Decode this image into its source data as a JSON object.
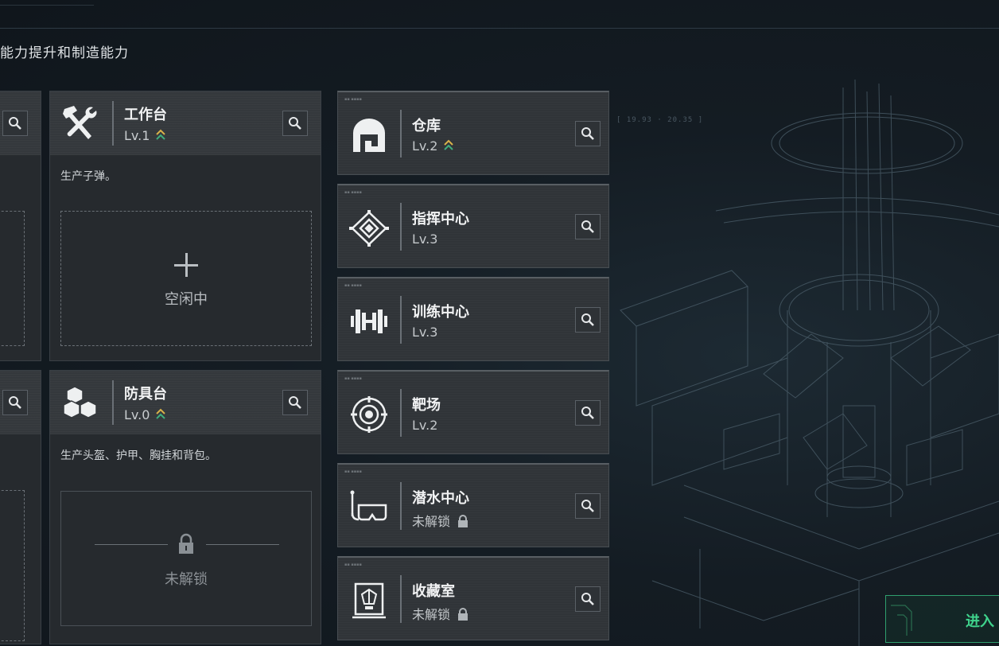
{
  "subtitle": "能力提升和制造能力",
  "left_cards": {
    "workbench": {
      "name": "工作台",
      "level": "Lv.1",
      "desc": "生产子弹。",
      "slot_status": "空闲中"
    },
    "armor_bench": {
      "name": "防具台",
      "level": "Lv.0",
      "desc": "生产头盔、护甲、胸挂和背包。",
      "slot_status": "未解锁"
    }
  },
  "facilities": [
    {
      "name": "仓库",
      "level": "Lv.2",
      "icon": "warehouse-icon",
      "upgrade": true,
      "locked": false
    },
    {
      "name": "指挥中心",
      "level": "Lv.3",
      "icon": "command-center-icon",
      "upgrade": false,
      "locked": false
    },
    {
      "name": "训练中心",
      "level": "Lv.3",
      "icon": "dumbbell-icon",
      "upgrade": false,
      "locked": false
    },
    {
      "name": "靶场",
      "level": "Lv.2",
      "icon": "target-icon",
      "upgrade": false,
      "locked": false
    },
    {
      "name": "潜水中心",
      "level": "未解锁",
      "icon": "diving-mask-icon",
      "upgrade": false,
      "locked": true
    },
    {
      "name": "收藏室",
      "level": "未解锁",
      "icon": "collection-room-icon",
      "upgrade": false,
      "locked": true
    }
  ],
  "enter_button": {
    "label": "进入"
  },
  "colors": {
    "accent_green": "#3fd38c",
    "upgrade_gold": "#d9b24a",
    "upgrade_green": "#3fae7e"
  }
}
